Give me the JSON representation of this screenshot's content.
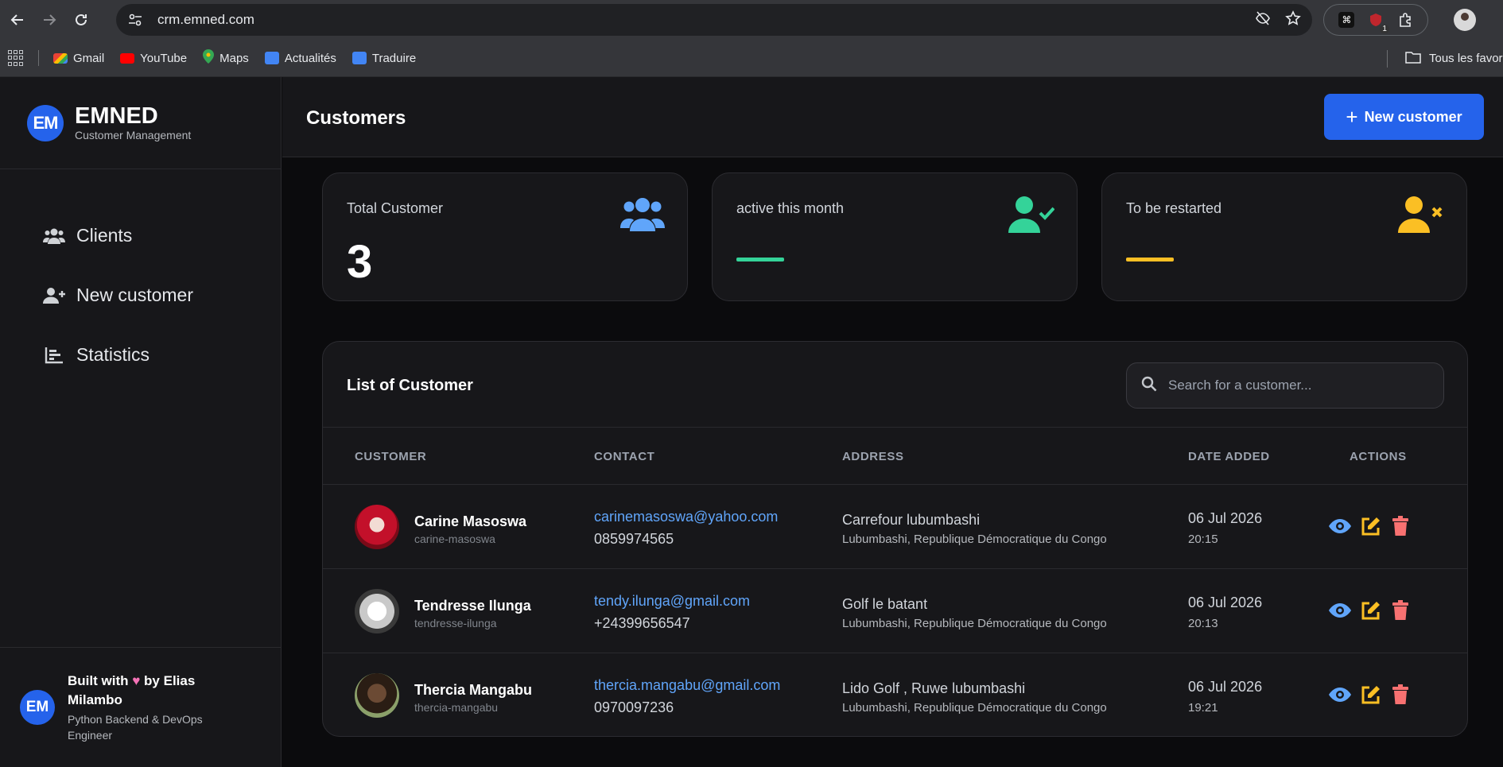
{
  "browser": {
    "url": "crm.emned.com",
    "bookmarks": [
      "Gmail",
      "YouTube",
      "Maps",
      "Actualités",
      "Traduire"
    ],
    "all_bookmarks": "Tous les favoris",
    "ext_badge": "1"
  },
  "brand": {
    "logo": "EM",
    "name": "EMNED",
    "subtitle": "Customer Management"
  },
  "sidebar": {
    "items": [
      {
        "label": "Clients",
        "icon": "users-icon"
      },
      {
        "label": "New customer",
        "icon": "user-plus-icon"
      },
      {
        "label": "Statistics",
        "icon": "bar-chart-icon"
      }
    ],
    "footer": {
      "logo": "EM",
      "built_with": "Built with",
      "by": "by Elias Milambo",
      "role": "Python Backend & DevOps Engineer"
    }
  },
  "header": {
    "title": "Customers",
    "new_button": "New customer"
  },
  "stats": [
    {
      "label": "Total Customer",
      "value": "3",
      "icon": "users-icon",
      "color": "#60a5fa"
    },
    {
      "label": "active this month",
      "value": "",
      "icon": "user-check-icon",
      "color": "#34d399"
    },
    {
      "label": "To be restarted",
      "value": "",
      "icon": "user-x-icon",
      "color": "#fbbf24"
    }
  ],
  "list": {
    "title": "List of Customer",
    "search_placeholder": "Search for a customer...",
    "columns": [
      "CUSTOMER",
      "CONTACT",
      "ADDRESS",
      "DATE ADDED",
      "ACTIONS"
    ],
    "rows": [
      {
        "name": "Carine Masoswa",
        "slug": "carine-masoswa",
        "email": "carinemasoswa@yahoo.com",
        "phone": "0859974565",
        "address": "Carrefour lubumbashi",
        "region": "Lubumbashi, Republique Démocratique du Congo",
        "date": "06 Jul 2026",
        "time": "20:15"
      },
      {
        "name": "Tendresse Ilunga",
        "slug": "tendresse-ilunga",
        "email": "tendy.ilunga@gmail.com",
        "phone": "+24399656547",
        "address": "Golf le batant",
        "region": "Lubumbashi, Republique Démocratique du Congo",
        "date": "06 Jul 2026",
        "time": "20:13"
      },
      {
        "name": "Thercia Mangabu",
        "slug": "thercia-mangabu",
        "email": "thercia.mangabu@gmail.com",
        "phone": "0970097236",
        "address": "Lido Golf , Ruwe lubumbashi",
        "region": "Lubumbashi, Republique Démocratique du Congo",
        "date": "06 Jul 2026",
        "time": "19:21"
      }
    ]
  },
  "colors": {
    "accent": "#2563eb",
    "view": "#60a5fa",
    "edit": "#fbbf24",
    "delete": "#f87171"
  }
}
